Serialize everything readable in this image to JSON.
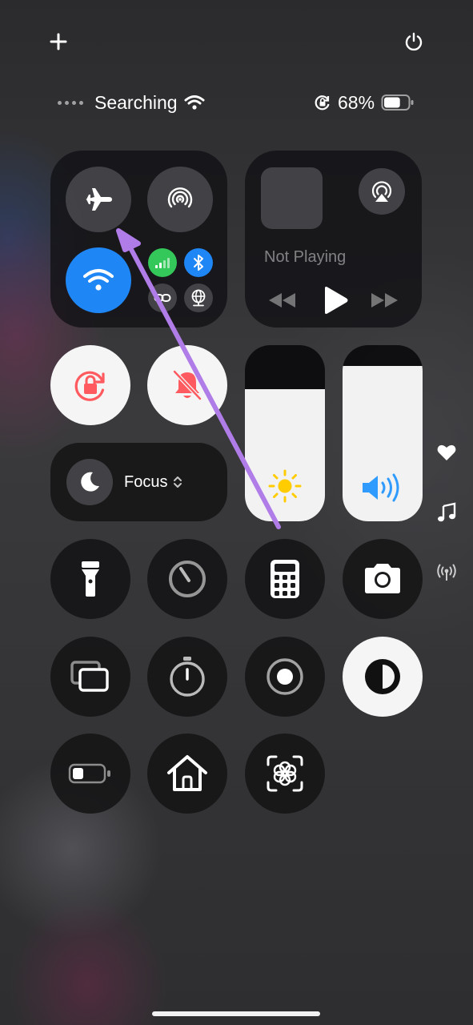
{
  "status_bar": {
    "carrier_text": "Searching",
    "battery_percent_text": "68%",
    "battery_level": 0.68
  },
  "connectivity": {
    "airplane_mode": false,
    "wifi_enabled": true,
    "cellular_enabled": true,
    "bluetooth_enabled": true
  },
  "now_playing": {
    "status_text": "Not Playing"
  },
  "focus": {
    "label": "Focus",
    "chevron": "⌃⌄"
  },
  "sliders": {
    "brightness_level": 0.75,
    "volume_level": 0.88
  },
  "side_indicators": [
    "heart-icon",
    "music-note-icon",
    "antenna-icon"
  ],
  "colors": {
    "accent_blue": "#1f86f5",
    "cellular_green": "#34c759",
    "orientation_lock_red": "#ff5a5f",
    "brightness_yellow": "#ffcc00",
    "volume_blue": "#2f9bff",
    "annotation_purple": "#b07ce8"
  }
}
